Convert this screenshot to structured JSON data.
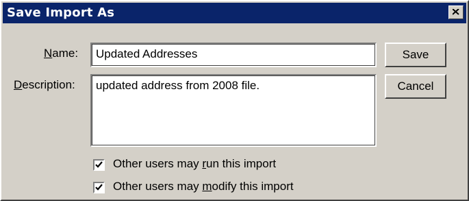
{
  "window": {
    "title": "Save Import As",
    "close_icon": "close-icon"
  },
  "form": {
    "name_label_prefix": "",
    "name_label_mnemonic": "N",
    "name_label_rest": "ame:",
    "name_value": "Updated Addresses",
    "description_label_mnemonic": "D",
    "description_label_rest": "escription:",
    "description_value": "updated address from 2008 file."
  },
  "buttons": {
    "save_label": "Save",
    "cancel_label": "Cancel"
  },
  "options": [
    {
      "label_before": "Other users may ",
      "label_mnemonic": "r",
      "label_after": "un this import",
      "checked": true
    },
    {
      "label_before": "Other users may ",
      "label_mnemonic": "m",
      "label_after": "odify this import",
      "checked": true
    }
  ]
}
